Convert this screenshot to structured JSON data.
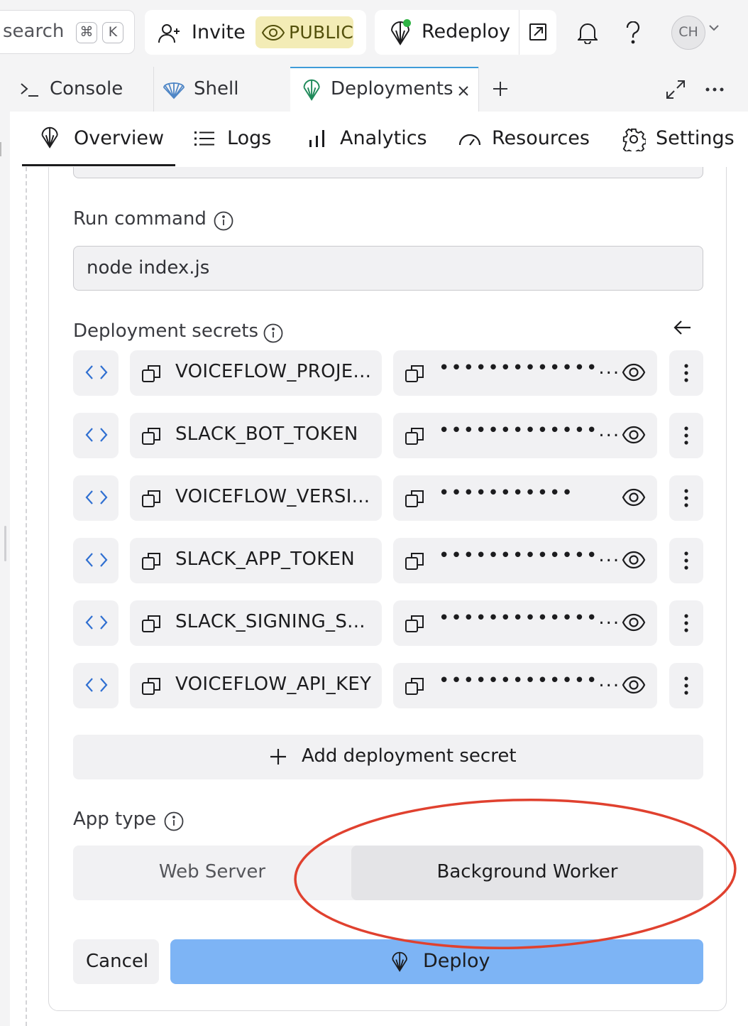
{
  "topbar": {
    "search": {
      "placeholder": "search",
      "shortcut_keys": [
        "⌘",
        "K"
      ]
    },
    "invite_label": "Invite",
    "public_badge": "PUBLIC",
    "redeploy_label": "Redeploy",
    "avatar_initials": "CH"
  },
  "tabs": [
    {
      "label": "Console",
      "icon": "terminal-icon"
    },
    {
      "label": "Shell",
      "icon": "shell-icon"
    },
    {
      "label": "Deployments",
      "icon": "deployments-icon",
      "active": true
    }
  ],
  "subnav": [
    {
      "label": "Overview",
      "icon": "deployments-icon",
      "active": true
    },
    {
      "label": "Logs",
      "icon": "list-icon"
    },
    {
      "label": "Analytics",
      "icon": "bar-chart-icon"
    },
    {
      "label": "Resources",
      "icon": "gauge-icon"
    },
    {
      "label": "Settings",
      "icon": "gear-icon"
    }
  ],
  "form": {
    "run_command": {
      "label": "Run command",
      "value": "node index.js"
    },
    "secrets": {
      "label": "Deployment secrets",
      "rows": [
        {
          "key": "VOICEFLOW_PROJE...",
          "masked": "•••••••••••••..."
        },
        {
          "key": "SLACK_BOT_TOKEN",
          "masked": "•••••••••••••..."
        },
        {
          "key": "VOICEFLOW_VERSI...",
          "masked": "•••••••••••"
        },
        {
          "key": "SLACK_APP_TOKEN",
          "masked": "•••••••••••••..."
        },
        {
          "key": "SLACK_SIGNING_S...",
          "masked": "•••••••••••••..."
        },
        {
          "key": "VOICEFLOW_API_KEY",
          "masked": "•••••••••••••..."
        }
      ],
      "add_label": "Add deployment secret"
    },
    "app_type": {
      "label": "App type",
      "options": [
        "Web Server",
        "Background Worker"
      ],
      "selected": "Background Worker"
    },
    "cancel_label": "Cancel",
    "deploy_label": "Deploy"
  },
  "colors": {
    "accent_tab": "#3f9bd8",
    "deploy_button": "#7db4f5",
    "public_badge_bg": "#f3ecb6",
    "status_dot": "#2fb344",
    "annotation_ellipse": "#e0412f"
  }
}
